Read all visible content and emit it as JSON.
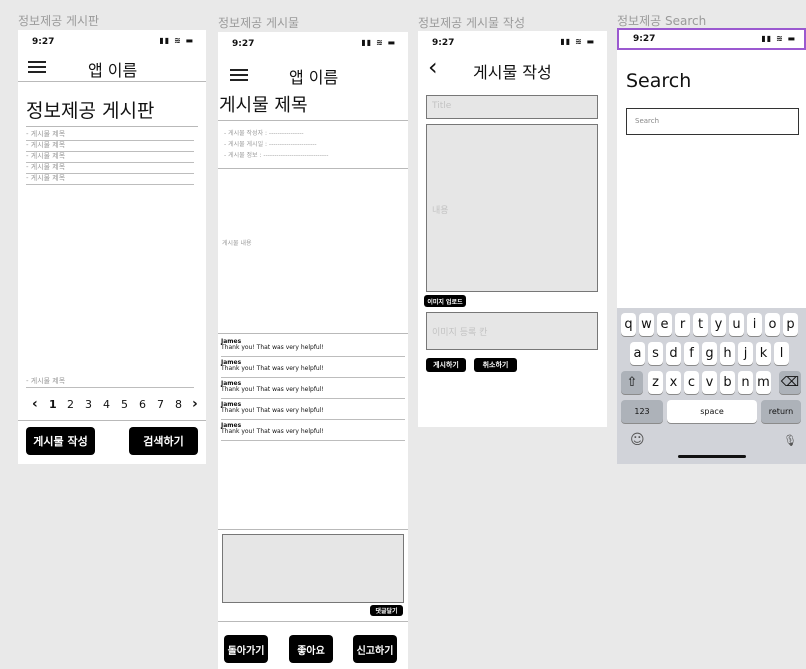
{
  "frames": {
    "board": {
      "label": "정보제공 게시판",
      "time": "9:27",
      "status_icons": "▮▮ ≋ ▬",
      "menu_icon": "hamburger-icon",
      "app_name": "앱 이름",
      "page_title": "정보제공 게시판",
      "posts": [
        "- 게시물 제목",
        "- 게시물 제목",
        "- 게시물 제목",
        "- 게시물 제목",
        "- 게시물 제목"
      ],
      "bottom_post": "- 게시물 제목",
      "pagination": {
        "prev": "‹",
        "pages": [
          "1",
          "2",
          "3",
          "4",
          "5",
          "6",
          "7",
          "8"
        ],
        "next": "›"
      },
      "write_button": "게시물 작성",
      "search_button": "검색하기"
    },
    "post": {
      "label": "정보제공 게시물",
      "time": "9:27",
      "status_icons": "▮▮ ≋ ▬",
      "menu_icon": "hamburger-icon",
      "app_name": "앱 이름",
      "title": "게시물 제목",
      "meta": [
        "- 게시물 작성자 : ----------------",
        "- 게시물 게시일 : ----------------------",
        "- 게시물 정보 : ------------------------------"
      ],
      "content": "게시물 내용",
      "comments": [
        {
          "name": "James",
          "text": "Thank you! That was very helpful!"
        },
        {
          "name": "James",
          "text": "Thank you! That was very helpful!"
        },
        {
          "name": "James",
          "text": "Thank you! That was very helpful!"
        },
        {
          "name": "James",
          "text": "Thank you! That was very helpful!"
        },
        {
          "name": "James",
          "text": "Thank you! That was very helpful!"
        }
      ],
      "comment_button": "댓글달기",
      "back_button": "돌아가기",
      "like_button": "좋아요",
      "report_button": "신고하기"
    },
    "write": {
      "label": "정보제공 게시물 작성",
      "time": "9:27",
      "status_icons": "▮▮ ≋ ▬",
      "back_icon": "chevron-left-icon",
      "back_glyph": "‹",
      "header_title": "게시물 작성",
      "title_placeholder": "Title",
      "content_placeholder": "내용",
      "image_upload_button": "이미지 업로드",
      "image_area_placeholder": "이미지 등록 칸",
      "post_button": "게시하기",
      "cancel_button": "취소하기"
    },
    "search": {
      "label": "정보제공 Search",
      "time": "9:27",
      "status_icons": "▮▮ ≋ ▬",
      "title": "Search",
      "search_placeholder": "Search",
      "keyboard": {
        "row1": [
          "q",
          "w",
          "e",
          "r",
          "t",
          "y",
          "u",
          "i",
          "o",
          "p"
        ],
        "row2": [
          "a",
          "s",
          "d",
          "f",
          "g",
          "h",
          "j",
          "k",
          "l"
        ],
        "row3": [
          "z",
          "x",
          "c",
          "v",
          "b",
          "n",
          "m"
        ],
        "shift": "⇧",
        "delete": "⌫",
        "numbers": "123",
        "space": "space",
        "return": "return",
        "emoji": "☺",
        "mic": "🎙"
      },
      "highlight_color": "#9b59d0"
    }
  }
}
